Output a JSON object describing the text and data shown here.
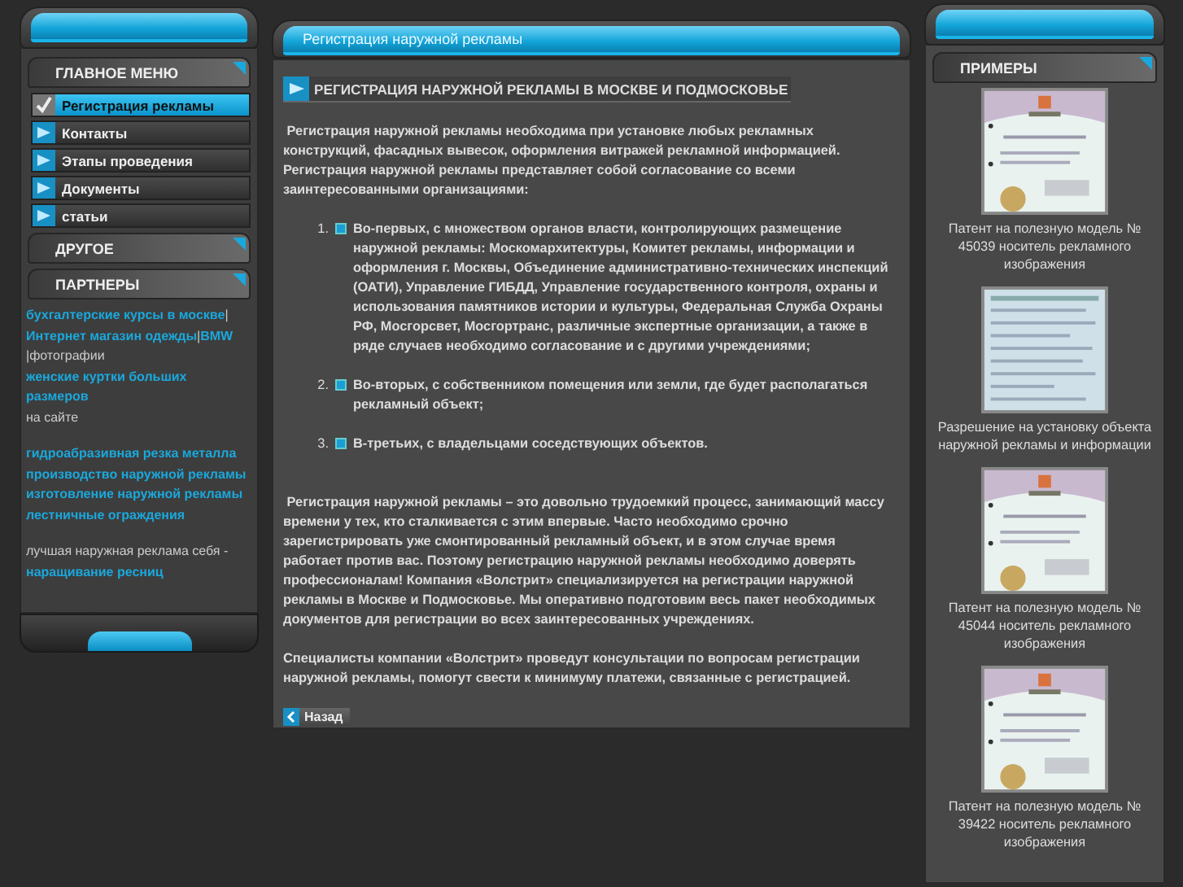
{
  "main_menu": {
    "title": "ГЛАВНОЕ МЕНЮ",
    "items": [
      {
        "label": "Регистрация рекламы",
        "selected": true
      },
      {
        "label": "Контакты",
        "selected": false
      },
      {
        "label": "Этапы проведения",
        "selected": false
      },
      {
        "label": "Документы",
        "selected": false
      },
      {
        "label": "статьи",
        "selected": false
      }
    ]
  },
  "other": {
    "title": "ДРУГОЕ"
  },
  "partners": {
    "title": "ПАРТНЕРЫ",
    "paragraphs": [
      [
        {
          "text": "бухгалтерские курсы в москве",
          "kind": "link"
        },
        {
          "text": "|",
          "kind": "text"
        },
        {
          "text": "Интернет магазин одежды",
          "kind": "link"
        },
        {
          "text": "|",
          "kind": "text"
        },
        {
          "text": "BMW",
          "kind": "link"
        },
        {
          "text": "|фотографии ",
          "kind": "text"
        },
        {
          "text": "женские куртки больших размеров",
          "kind": "link"
        },
        {
          "text": " на сайте",
          "kind": "text"
        }
      ],
      [
        {
          "text": "гидроабразивная резка металла",
          "kind": "link"
        },
        {
          "text": "производство наружной рекламы",
          "kind": "link"
        },
        {
          "text": "изготовление наружной рекламы",
          "kind": "link"
        },
        {
          "text": "лестничные ограждения",
          "kind": "link"
        }
      ],
      [
        {
          "text": "лучшая наружная реклама себя - ",
          "kind": "text"
        },
        {
          "text": "наращивание ресниц",
          "kind": "link"
        }
      ]
    ]
  },
  "content": {
    "breadcrumb": "Регистрация наружной рекламы",
    "heading": "РЕГИСТРАЦИЯ НАРУЖНОЙ РЕКЛАМЫ В МОСКВЕ И ПОДМОСКОВЬЕ",
    "intro": "Регистрация наружной рекламы необходима при установке любых рекламных конструкций, фасадных вывесок, оформления витражей рекламной информацией. Регистрация наружной рекламы представляет собой согласование со всеми заинтересованными организациями:",
    "list": [
      {
        "number": "1.",
        "text": "Во-первых, с множеством органов власти, контролирующих размещение наружной рекламы:  Москомархитектуры,  Комитет рекламы, информации и оформления г. Москвы, Объединение административно-технических инспекций (ОАТИ), Управление ГИБДД, Управление государственного контроля, охраны и использования памятников истории и культуры, Федеральная Служба Охраны РФ, Мосгорсвет, Мосгортранс, различные экспертные организации, а также в ряде случаев необходимо согласование и с другими учреждениями;"
      },
      {
        "number": "2.",
        "text": "Во-вторых, с собственником помещения или земли, где будет располагаться рекламный объект;"
      },
      {
        "number": "3.",
        "text": "В-третьих, с владельцами соседствующих объектов."
      }
    ],
    "paragraphs": [
      "Регистрация наружной рекламы – это довольно трудоемкий процесс, занимающий массу времени у тех, кто сталкивается с этим впервые. Часто необходимо срочно зарегистрировать уже смонтированный рекламный объект, и в этом случае время работает против вас. Поэтому регистрацию наружной рекламы необходимо доверять профессионалам! Компания «Волстрит» специализируется на регистрации наружной рекламы в Москве и Подмосковье. Мы оперативно подготовим весь пакет необходимых документов для регистрации во всех заинтересованных учреждениях.",
      "Специалисты компании «Волстрит» проведут консультации по вопросам регистрации наружной рекламы, помогут свести к минимуму платежи, связанные с регистрацией."
    ],
    "back": "Назад"
  },
  "examples": {
    "title": "ПРИМЕРЫ",
    "items": [
      {
        "kind": "patent",
        "caption": "Патент на полезную модель № 45039 носитель рекламного изображения"
      },
      {
        "kind": "permit",
        "caption": "Разрешение на установку объекта наружной рекламы и информации"
      },
      {
        "kind": "patent",
        "caption": "Патент на полезную модель № 45044 носитель рекламного изображения"
      },
      {
        "kind": "patent",
        "caption": "Патент на полезную модель № 39422 носитель рекламного изображения"
      }
    ]
  }
}
